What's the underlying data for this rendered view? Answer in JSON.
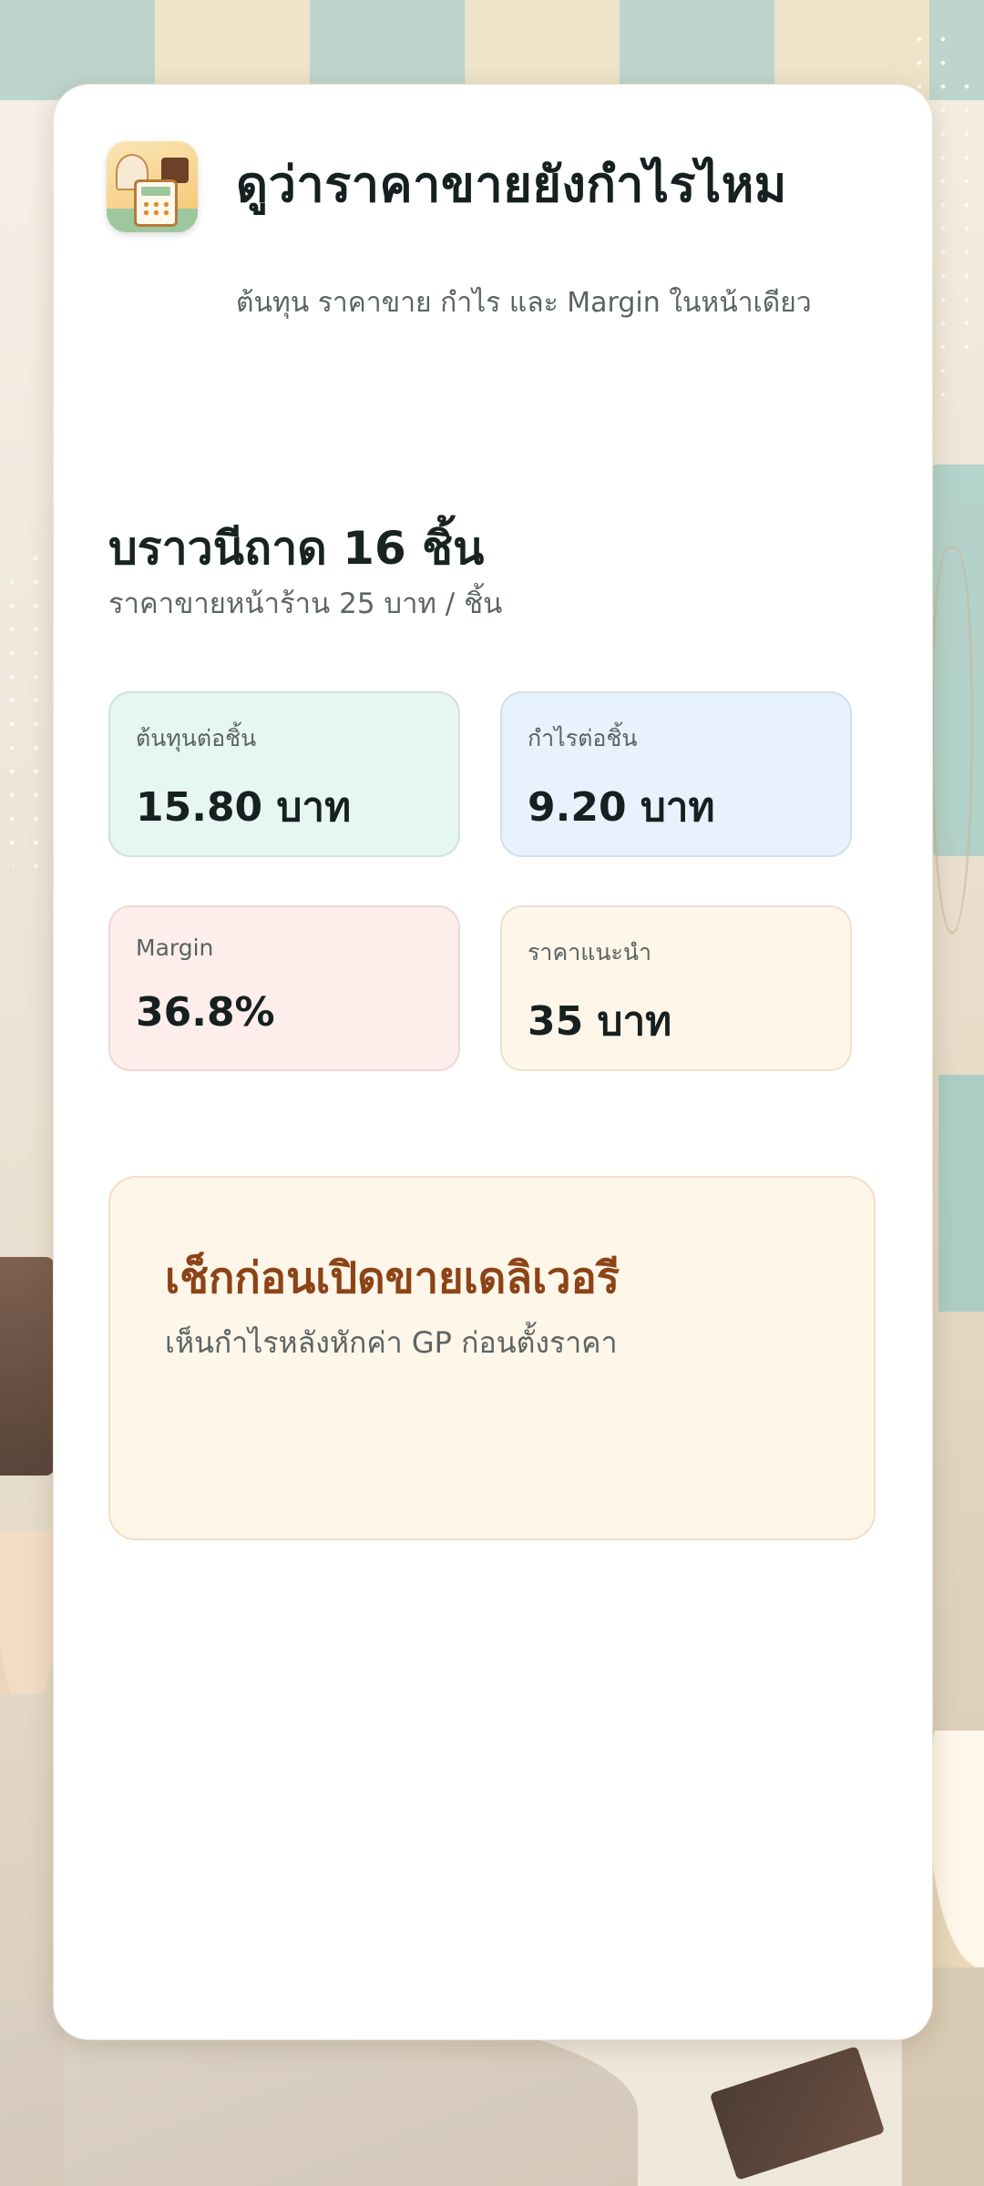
{
  "header": {
    "title": "ดูว่าราคาขายยังกำไรไหม",
    "subtitle": "ต้นทุน ราคาขาย กำไร และ Margin ในหน้าเดียว"
  },
  "product": {
    "name": "บราวนีถาด 16 ชิ้น",
    "price_line": "ราคาขายหน้าร้าน 25 บาท / ชิ้น"
  },
  "metrics": [
    {
      "label": "ต้นทุนต่อชิ้น",
      "value": "15.80 บาท",
      "color": "#e6f6f1"
    },
    {
      "label": "กำไรต่อชิ้น",
      "value": "9.20 บาท",
      "color": "#e8f2fc"
    },
    {
      "label": "Margin",
      "value": "36.8%",
      "color": "#fdeeec"
    },
    {
      "label": "ราคาแนะนำ",
      "value": "35 บาท",
      "color": "#fdf6e9"
    }
  ],
  "notice": {
    "title": "เช็กก่อนเปิดขายเดลิเวอรี",
    "subtitle": "เห็นกำไรหลังหักค่า GP ก่อนตั้งราคา",
    "title_color": "#8c4316"
  },
  "app_icon": "bakery-calculator-icon"
}
